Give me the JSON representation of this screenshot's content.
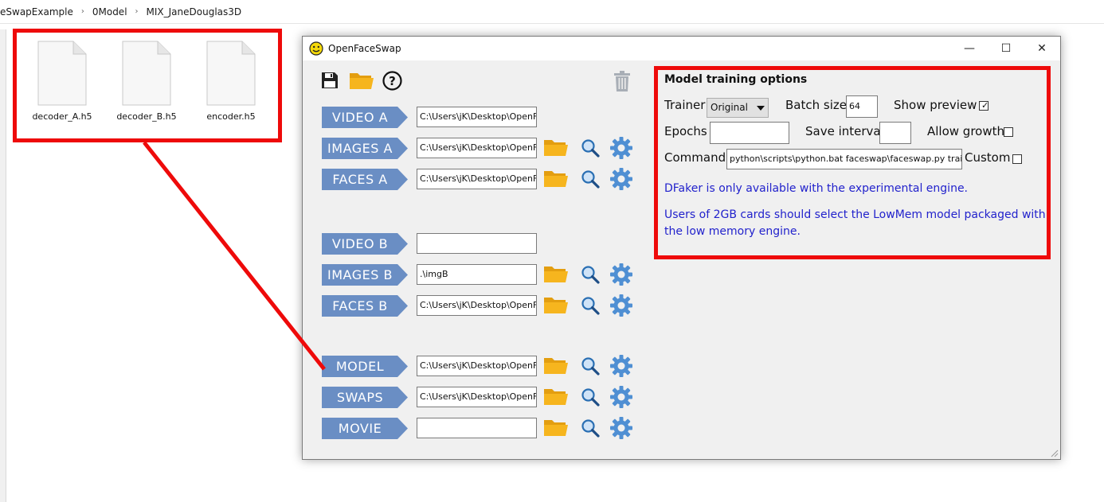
{
  "explorer": {
    "breadcrumb": [
      "eSwapExample",
      "0Model",
      "MIX_JaneDouglas3D"
    ],
    "files": [
      {
        "name": "decoder_A.h5"
      },
      {
        "name": "decoder_B.h5"
      },
      {
        "name": "encoder.h5"
      }
    ]
  },
  "window": {
    "title": "OpenFaceSwap",
    "controls": {
      "minimize": "—",
      "maximize": "☐",
      "close": "✕"
    }
  },
  "toolbar": {
    "icons": [
      "save-icon",
      "open-folder-icon",
      "help-icon",
      "trash-icon"
    ]
  },
  "rows": [
    {
      "label": "VIDEO A",
      "value": "C:\\Users\\jK\\Desktop\\OpenF",
      "has_tools": false
    },
    {
      "label": "IMAGES A",
      "value": "C:\\Users\\jK\\Desktop\\OpenF",
      "has_tools": true
    },
    {
      "label": "FACES A",
      "value": "C:\\Users\\jK\\Desktop\\OpenF",
      "has_tools": true
    },
    {
      "label": "VIDEO B",
      "value": "",
      "has_tools": false
    },
    {
      "label": "IMAGES B",
      "value": ".\\imgB",
      "has_tools": true
    },
    {
      "label": "FACES B",
      "value": "C:\\Users\\jK\\Desktop\\OpenF",
      "has_tools": true
    },
    {
      "label": "MODEL",
      "value": "C:\\Users\\jK\\Desktop\\OpenF",
      "has_tools": true
    },
    {
      "label": "SWAPS",
      "value": "C:\\Users\\jK\\Desktop\\OpenF",
      "has_tools": true
    },
    {
      "label": "MOVIE",
      "value": "",
      "has_tools": true
    }
  ],
  "options": {
    "title": "Model training options",
    "trainer_label": "Trainer",
    "trainer_value": "Original",
    "batch_size_label": "Batch size",
    "batch_size_value": "64",
    "show_preview_label": "Show preview",
    "show_preview_checked": "✓",
    "epochs_label": "Epochs",
    "epochs_value": "",
    "save_interval_label": "Save interval",
    "save_interval_value": "",
    "allow_growth_label": "Allow growth",
    "command_label": "Command",
    "command_value": "python\\scripts\\python.bat faceswap\\faceswap.py train",
    "custom_label": "Custom",
    "info_1": "DFaker is only available with the experimental engine.",
    "info_2": "Users of 2GB cards should select the LowMem model packaged with the low memory engine."
  },
  "colors": {
    "accent_red": "#ee0a0a",
    "label_blue": "#6a8ec4",
    "info_text": "#2222cc",
    "folder_yellow": "#f6b51e",
    "gear_blue": "#4f8fd3"
  }
}
